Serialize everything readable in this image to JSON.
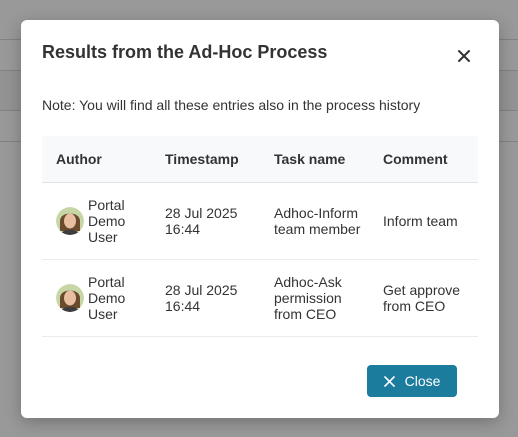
{
  "dialog": {
    "title": "Results from the Ad-Hoc Process",
    "note": "Note: You will find all these entries also in the process history",
    "close_icon": "close-icon",
    "close_button_label": "Close",
    "close_button_icon": "close-icon",
    "accent_color": "#1b7c9e"
  },
  "table": {
    "headers": {
      "author": "Author",
      "timestamp": "Timestamp",
      "task_name": "Task name",
      "comment": "Comment"
    },
    "rows": [
      {
        "author": "Portal Demo User",
        "timestamp": "28 Jul 2025 16:44",
        "task_name": "Adhoc-Inform team member",
        "comment": "Inform team",
        "avatar_icon": "user-avatar"
      },
      {
        "author": "Portal Demo User",
        "timestamp": "28 Jul 2025 16:44",
        "task_name": "Adhoc-Ask permission from CEO",
        "comment": "Get approve from CEO",
        "avatar_icon": "user-avatar"
      }
    ]
  }
}
